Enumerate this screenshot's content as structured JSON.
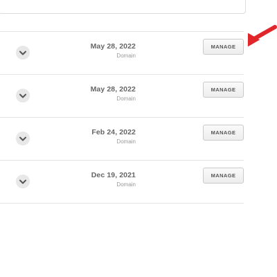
{
  "domains": {
    "rows": [
      {
        "date": "May 28, 2022",
        "type": "Domain",
        "manage_label": "MANAGE"
      },
      {
        "date": "May 28, 2022",
        "type": "Domain",
        "manage_label": "MANAGE"
      },
      {
        "date": "Feb 24, 2022",
        "type": "Domain",
        "manage_label": "MANAGE"
      },
      {
        "date": "Dec 19, 2021",
        "type": "Domain",
        "manage_label": "MANAGE"
      }
    ]
  },
  "icons": {
    "expand": "chevron-down-icon",
    "annotation": "red-arrow-icon"
  },
  "colors": {
    "accent_green": "#3aa17e",
    "annotation_red": "#e0262b",
    "border": "#e3e3e3"
  }
}
